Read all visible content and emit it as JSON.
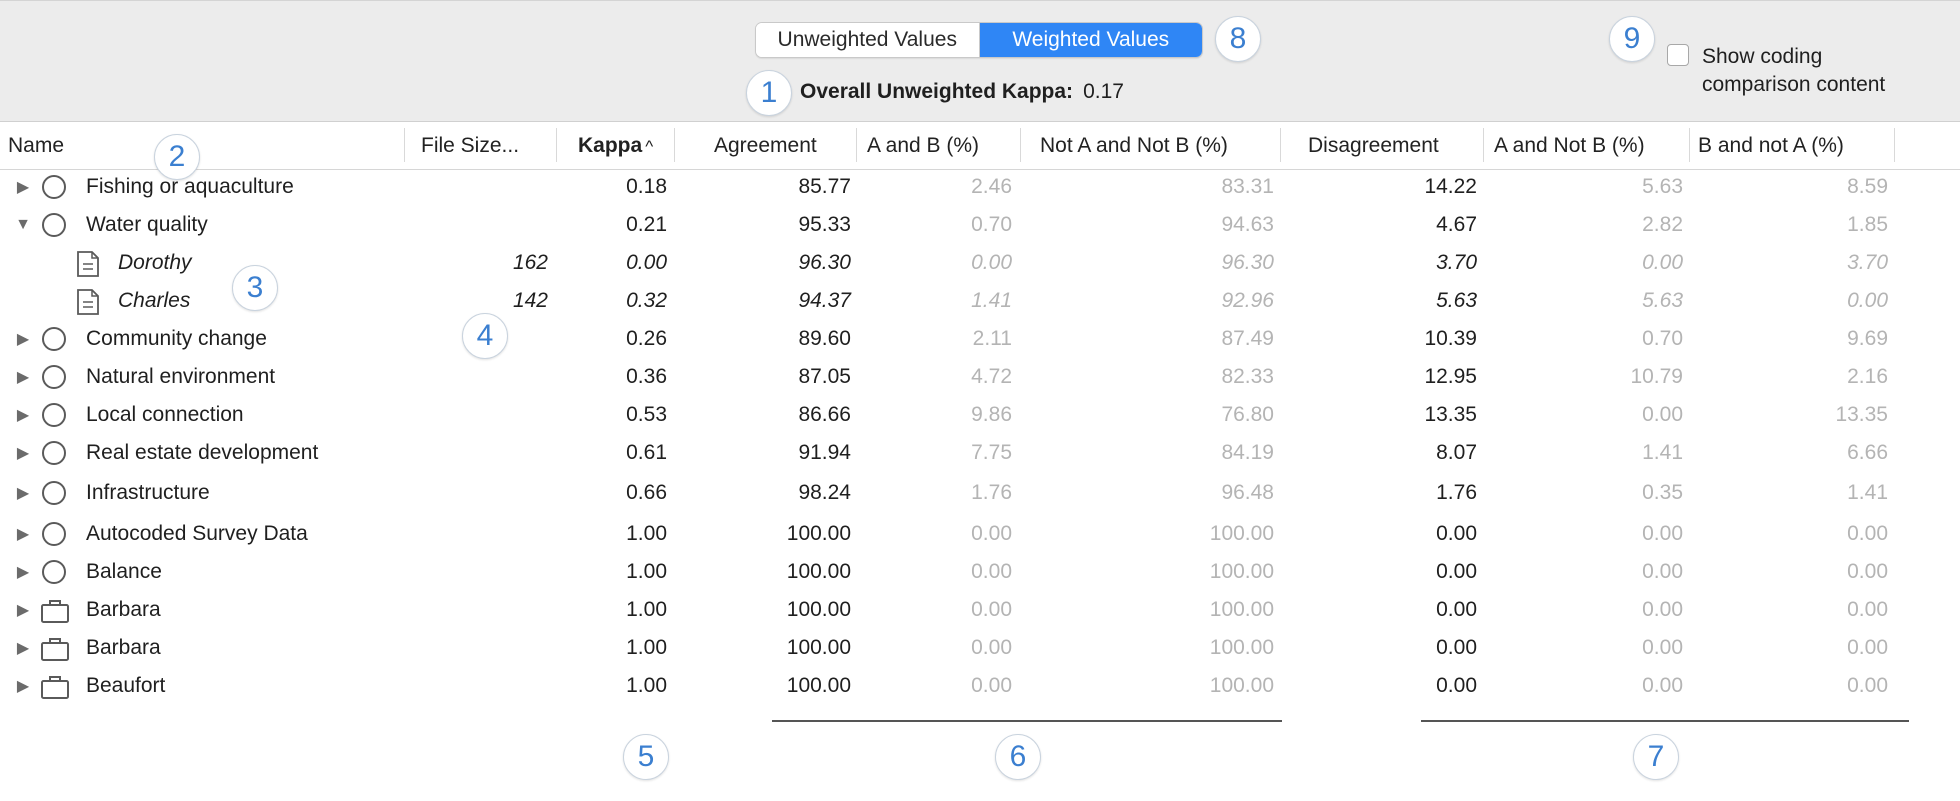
{
  "toolbar": {
    "segments": [
      {
        "label": "Unweighted Values",
        "active": false
      },
      {
        "label": "Weighted Values",
        "active": true
      }
    ],
    "kappa_label": "Overall Unweighted Kappa:",
    "kappa_value": "0.17",
    "checkbox_label": "Show coding comparison content",
    "checkbox_checked": false
  },
  "callouts": [
    "1",
    "2",
    "3",
    "4",
    "5",
    "6",
    "7",
    "8",
    "9"
  ],
  "columns": {
    "name": "Name",
    "file_size": "File Size...",
    "kappa": "Kappa",
    "agreement": "Agreement",
    "a_and_b": "A and B (%)",
    "not_a_not_b": "Not A and Not B (%)",
    "disagreement": "Disagreement",
    "a_not_b": "A and Not B (%)",
    "b_not_a": "B and not A (%)"
  },
  "sort": {
    "column": "Kappa",
    "direction": "ascending"
  },
  "colors": {
    "accent": "#2f86f5",
    "callout": "#3b7fd0",
    "muted": "#b4b4b4"
  },
  "rows": [
    {
      "name": "Fishing or aquaculture",
      "icon": "node-circle-icon",
      "disclosure": "collapsed",
      "file_size": "",
      "kappa": "0.18",
      "agreement": "85.77",
      "a_and_b": "2.46",
      "not_a_not_b": "83.31",
      "disagreement": "14.22",
      "a_not_b": "5.63",
      "b_not_a": "8.59"
    },
    {
      "name": "Water quality",
      "icon": "node-circle-icon",
      "disclosure": "expanded",
      "file_size": "",
      "kappa": "0.21",
      "agreement": "95.33",
      "a_and_b": "0.70",
      "not_a_not_b": "94.63",
      "disagreement": "4.67",
      "a_not_b": "2.82",
      "b_not_a": "1.85"
    },
    {
      "name": "Dorothy",
      "icon": "document-icon",
      "disclosure": "none",
      "child": true,
      "file_size": "162",
      "kappa": "0.00",
      "agreement": "96.30",
      "a_and_b": "0.00",
      "not_a_not_b": "96.30",
      "disagreement": "3.70",
      "a_not_b": "0.00",
      "b_not_a": "3.70"
    },
    {
      "name": "Charles",
      "icon": "document-icon",
      "disclosure": "none",
      "child": true,
      "file_size": "142",
      "kappa": "0.32",
      "agreement": "94.37",
      "a_and_b": "1.41",
      "not_a_not_b": "92.96",
      "disagreement": "5.63",
      "a_not_b": "5.63",
      "b_not_a": "0.00"
    },
    {
      "name": "Community change",
      "icon": "node-circle-icon",
      "disclosure": "collapsed",
      "file_size": "",
      "kappa": "0.26",
      "agreement": "89.60",
      "a_and_b": "2.11",
      "not_a_not_b": "87.49",
      "disagreement": "10.39",
      "a_not_b": "0.70",
      "b_not_a": "9.69"
    },
    {
      "name": "Natural environment",
      "icon": "node-circle-icon",
      "disclosure": "collapsed",
      "file_size": "",
      "kappa": "0.36",
      "agreement": "87.05",
      "a_and_b": "4.72",
      "not_a_not_b": "82.33",
      "disagreement": "12.95",
      "a_not_b": "10.79",
      "b_not_a": "2.16"
    },
    {
      "name": "Local connection",
      "icon": "node-circle-icon",
      "disclosure": "collapsed",
      "file_size": "",
      "kappa": "0.53",
      "agreement": "86.66",
      "a_and_b": "9.86",
      "not_a_not_b": "76.80",
      "disagreement": "13.35",
      "a_not_b": "0.00",
      "b_not_a": "13.35"
    },
    {
      "name": "Real estate development",
      "icon": "node-circle-icon",
      "disclosure": "collapsed",
      "file_size": "",
      "kappa": "0.61",
      "agreement": "91.94",
      "a_and_b": "7.75",
      "not_a_not_b": "84.19",
      "disagreement": "8.07",
      "a_not_b": "1.41",
      "b_not_a": "6.66"
    },
    {
      "name": "Infrastructure",
      "icon": "node-circle-icon",
      "disclosure": "collapsed",
      "file_size": "",
      "kappa": "0.66",
      "agreement": "98.24",
      "a_and_b": "1.76",
      "not_a_not_b": "96.48",
      "disagreement": "1.76",
      "a_not_b": "0.35",
      "b_not_a": "1.41"
    },
    {
      "name": "Autocoded Survey Data",
      "icon": "node-circle-icon",
      "disclosure": "collapsed",
      "file_size": "",
      "kappa": "1.00",
      "agreement": "100.00",
      "a_and_b": "0.00",
      "not_a_not_b": "100.00",
      "disagreement": "0.00",
      "a_not_b": "0.00",
      "b_not_a": "0.00"
    },
    {
      "name": "Balance",
      "icon": "node-circle-icon",
      "disclosure": "collapsed",
      "file_size": "",
      "kappa": "1.00",
      "agreement": "100.00",
      "a_and_b": "0.00",
      "not_a_not_b": "100.00",
      "disagreement": "0.00",
      "a_not_b": "0.00",
      "b_not_a": "0.00"
    },
    {
      "name": "Barbara",
      "icon": "case-icon",
      "disclosure": "collapsed",
      "file_size": "",
      "kappa": "1.00",
      "agreement": "100.00",
      "a_and_b": "0.00",
      "not_a_not_b": "100.00",
      "disagreement": "0.00",
      "a_not_b": "0.00",
      "b_not_a": "0.00"
    },
    {
      "name": "Barbara",
      "icon": "case-icon",
      "disclosure": "collapsed",
      "file_size": "",
      "kappa": "1.00",
      "agreement": "100.00",
      "a_and_b": "0.00",
      "not_a_not_b": "100.00",
      "disagreement": "0.00",
      "a_not_b": "0.00",
      "b_not_a": "0.00"
    },
    {
      "name": "Beaufort",
      "icon": "case-icon",
      "disclosure": "collapsed",
      "file_size": "",
      "kappa": "1.00",
      "agreement": "100.00",
      "a_and_b": "0.00",
      "not_a_not_b": "100.00",
      "disagreement": "0.00",
      "a_not_b": "0.00",
      "b_not_a": "0.00"
    }
  ]
}
